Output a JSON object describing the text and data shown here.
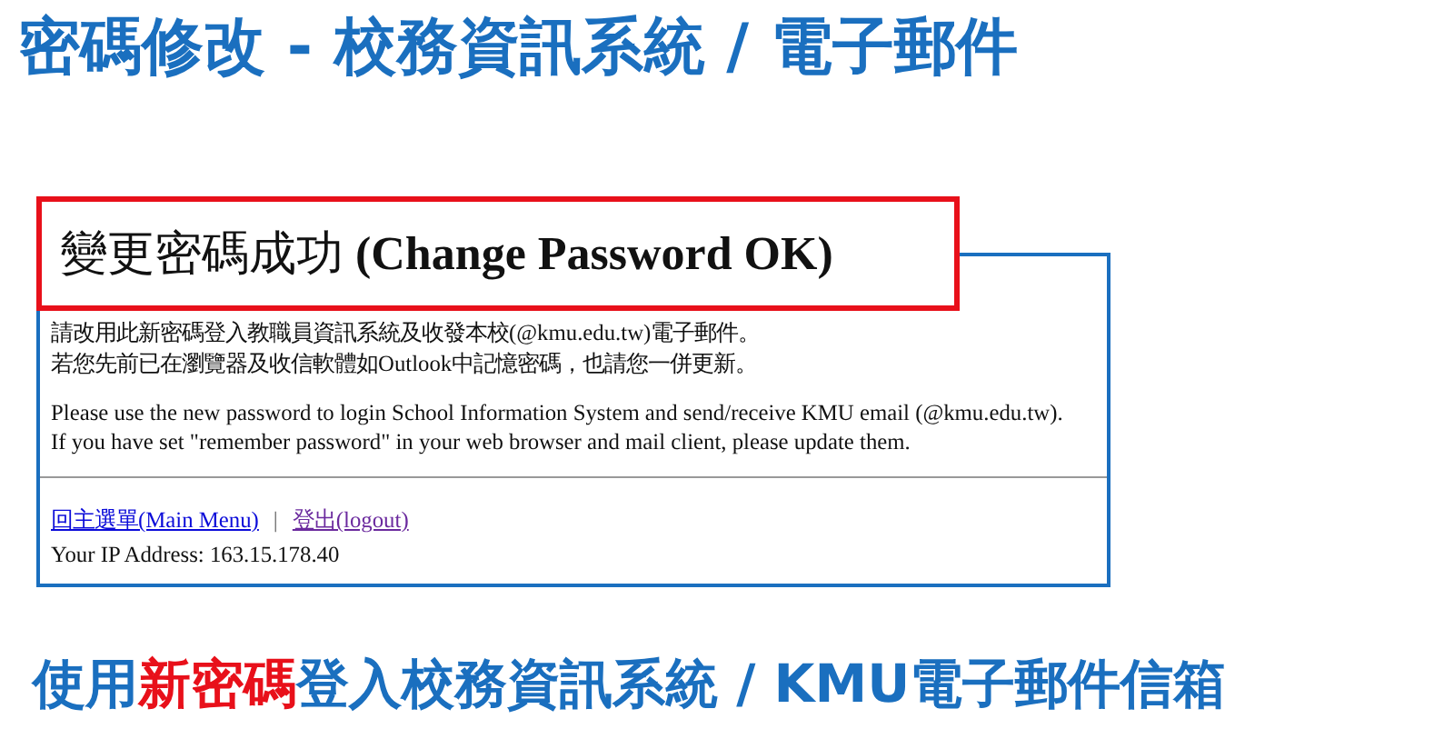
{
  "slide_title": "密碼修改 - 校務資訊系統 / 電子郵件",
  "screenshot": {
    "heading": "變更密碼成功 **(Change Password OK)**",
    "paragraphs": [
      [
        "請改用此新密碼登入教職員資訊系統及收發本校(@kmu.edu.tw)電子郵件。",
        "若您先前已在瀏覽器及收信軟體如Outlook中記憶密碼，也請您一併更新。"
      ],
      [
        "Please use the new password to login School Information System and send/receive KMU email (@kmu.edu.tw).",
        "If you have set \"remember password\" in your web browser and mail client, please update them."
      ]
    ],
    "links": [
      {
        "label": "回主選單(Main Menu)",
        "visited": false
      },
      {
        "label": "登出(logout)",
        "visited": true
      }
    ],
    "separator": "|",
    "ip_address": "Your IP Address: 163.15.178.40"
  },
  "caption": [
    {
      "text": "使用",
      "highlighted": false
    },
    {
      "text": "新密碼",
      "highlighted": true
    },
    {
      "text": "登入校務資訊系統 / KMU電子郵件信箱",
      "highlighted": false
    }
  ]
}
